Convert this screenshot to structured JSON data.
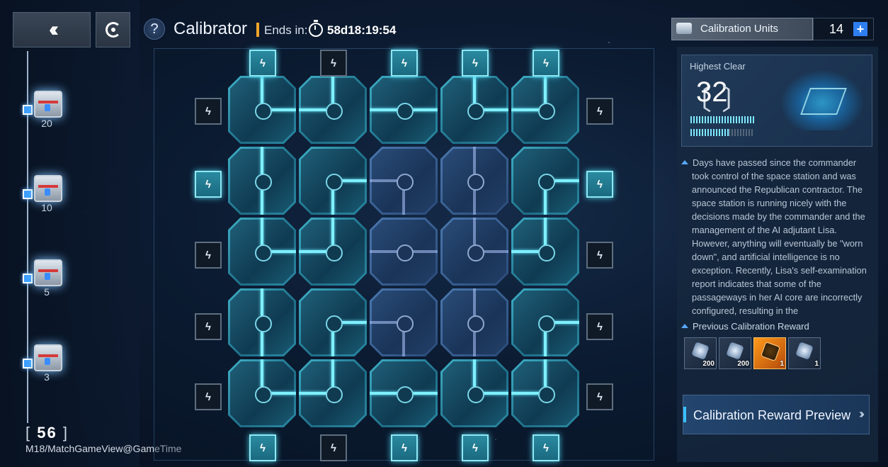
{
  "header": {
    "help_icon": "?",
    "title": "Calibrator",
    "ends_label": "Ends in:",
    "timer": "58d18:19:54"
  },
  "sidebar": {
    "back_icon": "double-chevron-left-icon",
    "target_icon": "target-icon",
    "milestones": [
      {
        "label": "20"
      },
      {
        "label": "10"
      },
      {
        "label": "5"
      },
      {
        "label": "3"
      }
    ],
    "score_open": "[",
    "score": "56",
    "score_close": "]",
    "debug": "M18/MatchGameView@GameTime"
  },
  "board": {
    "port_glyph": "ϟ",
    "top_ports": [
      true,
      false,
      true,
      true,
      true
    ],
    "bottom_ports": [
      true,
      false,
      true,
      true,
      true
    ],
    "left_ports": [
      false,
      true,
      false,
      false,
      false
    ],
    "right_ports": [
      false,
      true,
      false,
      false,
      false
    ]
  },
  "units": {
    "label": "Calibration Units",
    "count": "14",
    "add": "+"
  },
  "highest_clear": {
    "label": "Highest Clear",
    "bracket_open": "〔",
    "value": "32",
    "bracket_close": "〕"
  },
  "story": {
    "text": "Days have passed since the commander took control of the space station and was announced the Republican contractor. The space station is running nicely with the decisions made by the commander and the management of the AI adjutant Lisa. However, anything will eventually be \"worn down\", and artificial intelligence is no exception. Recently, Lisa's self-examination report indicates that some of the passageways in her AI core are incorrectly configured, resulting in the"
  },
  "rewards": {
    "title": "Previous Calibration Reward",
    "items": [
      {
        "qty": "200",
        "icon": "crystal-dark-icon"
      },
      {
        "qty": "200",
        "icon": "crystal-white-icon"
      },
      {
        "qty": "1",
        "icon": "chip-gold-icon"
      },
      {
        "qty": "1",
        "icon": "module-blue-icon"
      }
    ]
  },
  "preview": {
    "label": "Calibration Reward Preview",
    "chevron": "››"
  }
}
